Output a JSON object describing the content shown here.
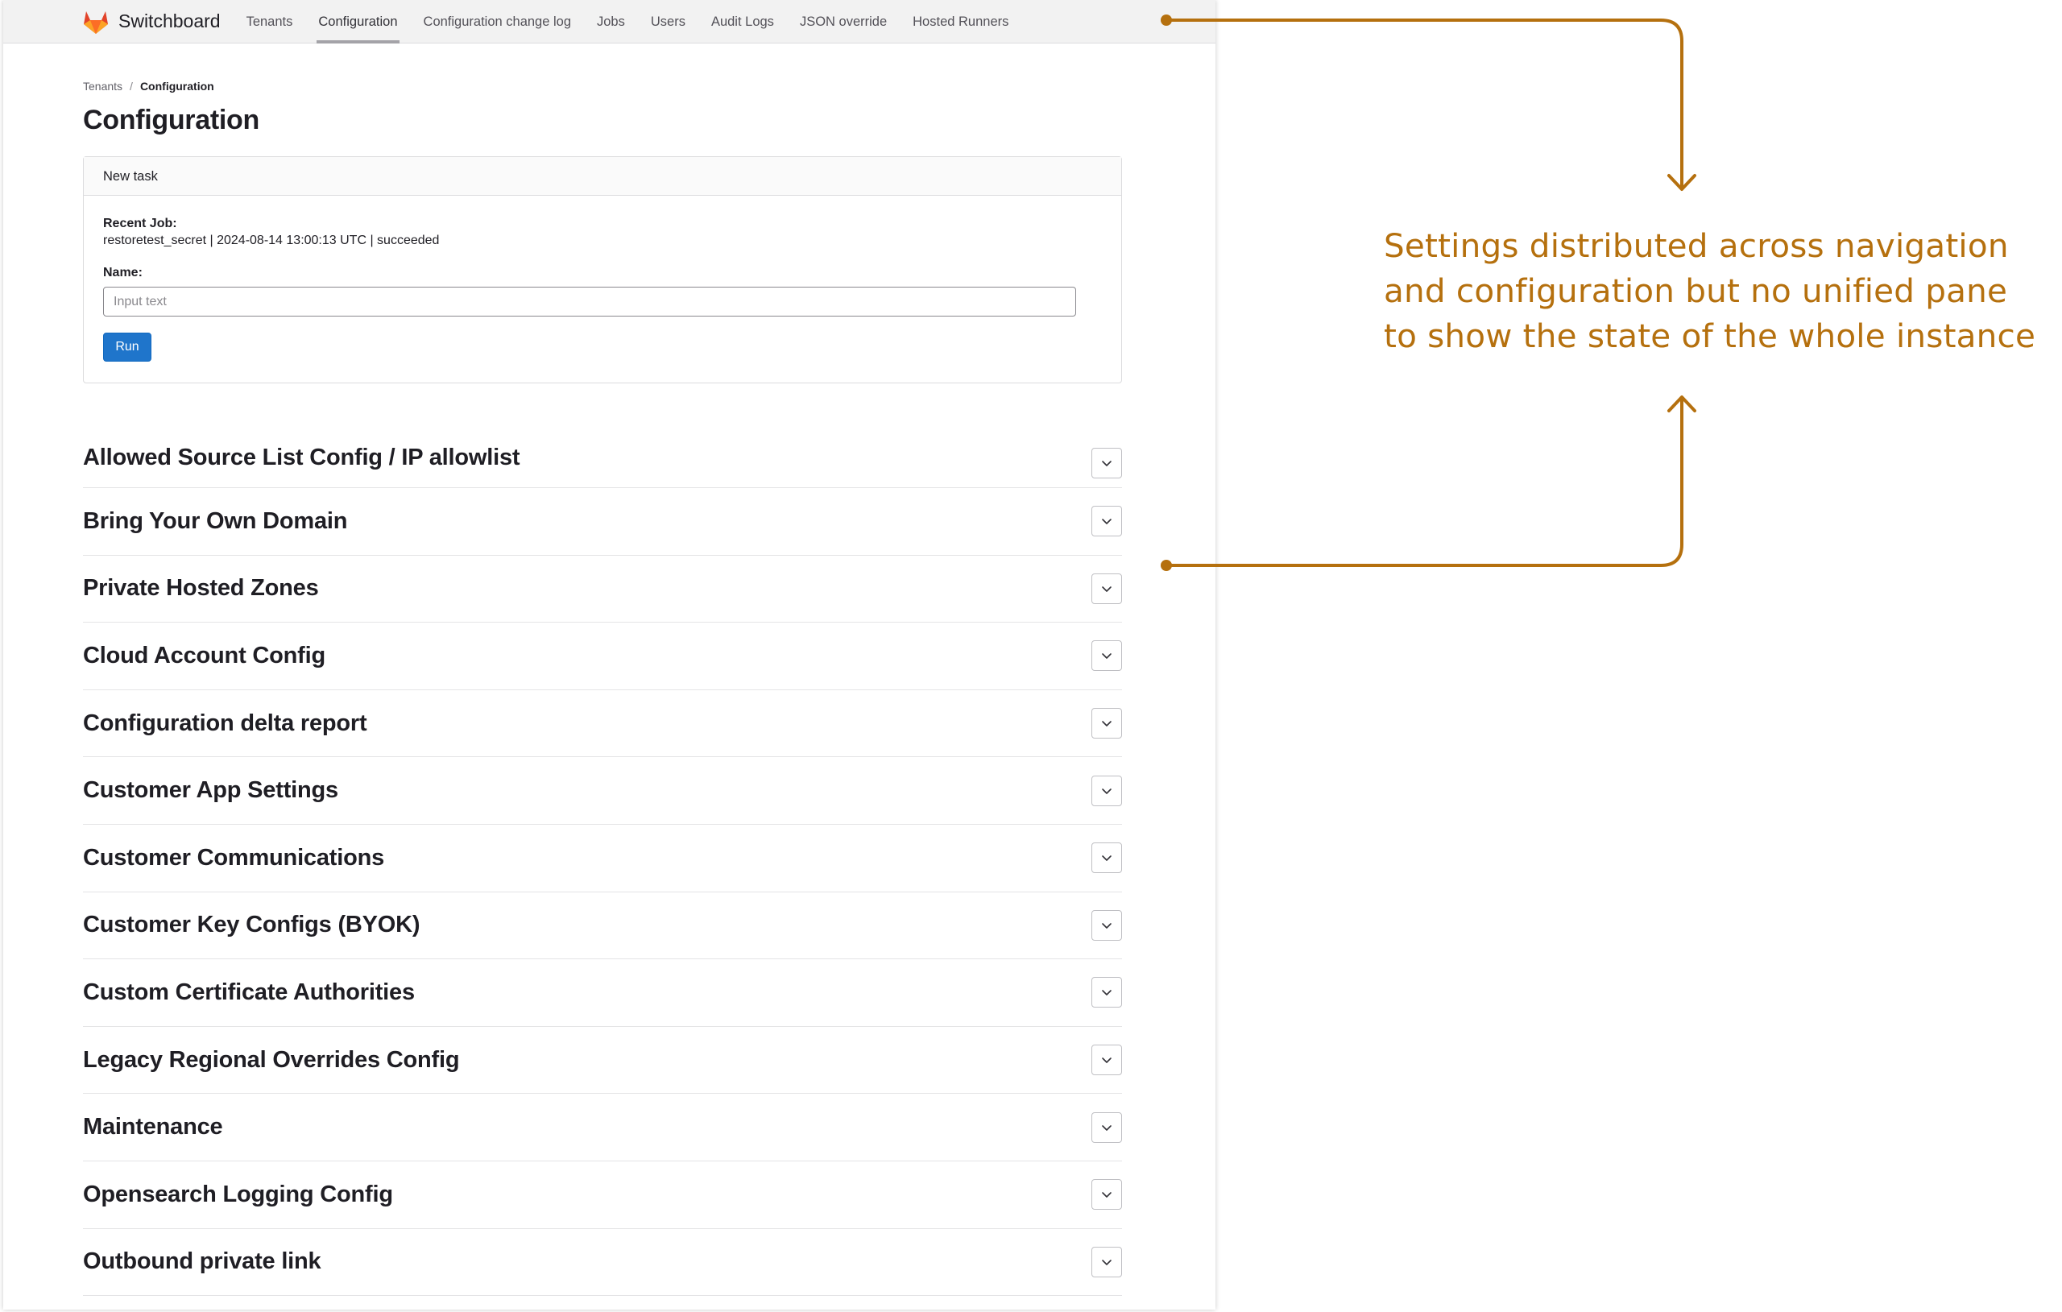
{
  "brand": {
    "name": "Switchboard",
    "logo_icon": "fox-logo-icon",
    "logo_color": "#e24329"
  },
  "nav": {
    "tabs": [
      {
        "label": "Tenants",
        "active": false
      },
      {
        "label": "Configuration",
        "active": true
      },
      {
        "label": "Configuration change log",
        "active": false
      },
      {
        "label": "Jobs",
        "active": false
      },
      {
        "label": "Users",
        "active": false
      },
      {
        "label": "Audit Logs",
        "active": false
      },
      {
        "label": "JSON override",
        "active": false
      },
      {
        "label": "Hosted Runners",
        "active": false
      }
    ]
  },
  "breadcrumb": {
    "items": [
      "Tenants",
      "Configuration"
    ],
    "separator": "/"
  },
  "page": {
    "title": "Configuration"
  },
  "task": {
    "header": "New task",
    "recent_job_label": "Recent Job:",
    "recent_job_value": "restoretest_secret | 2024-08-14 13:00:13 UTC | succeeded",
    "name_label": "Name:",
    "name_placeholder": "Input text",
    "name_value": "",
    "run_label": "Run",
    "run_color": "#1f75cb"
  },
  "sections": [
    "Allowed Source List Config / IP allowlist",
    "Bring Your Own Domain",
    "Private Hosted Zones",
    "Cloud Account Config",
    "Configuration delta report",
    "Customer App Settings",
    "Customer Communications",
    "Customer Key Configs (BYOK)",
    "Custom Certificate Authorities",
    "Legacy Regional Overrides Config",
    "Maintenance",
    "Opensearch Logging Config",
    "Outbound private link"
  ],
  "annotation": {
    "lines": [
      "Settings distributed across navigation",
      "and configuration but no unified pane",
      "to show the state of the whole instance"
    ],
    "color": "#b5700e"
  }
}
